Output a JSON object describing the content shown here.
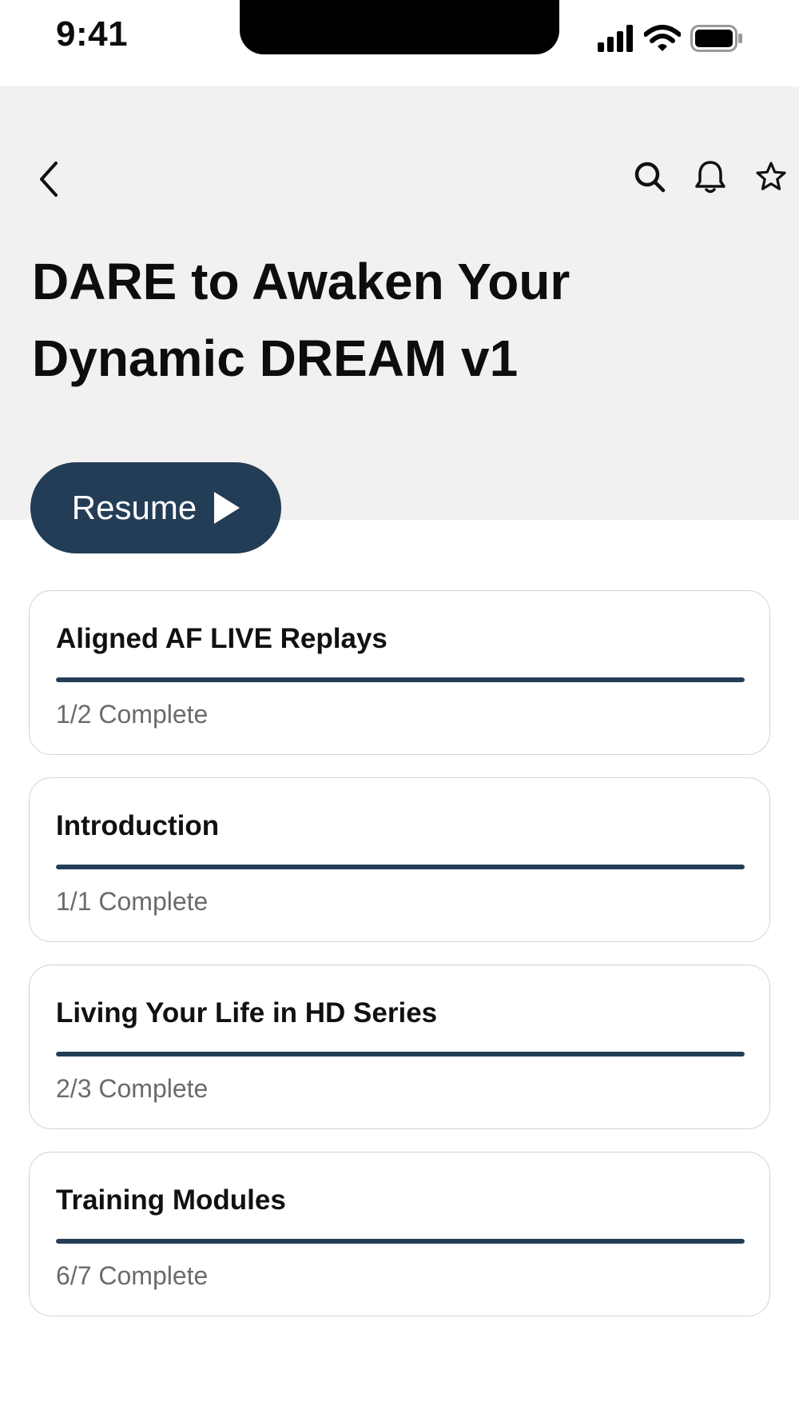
{
  "status_bar": {
    "time": "9:41",
    "icons": [
      "signal-icon",
      "wifi-icon",
      "battery-icon"
    ]
  },
  "header": {
    "back_icon": "chevron-left-icon",
    "actions": [
      "search-icon",
      "bell-icon",
      "star-icon"
    ],
    "title": "DARE to Awaken Your Dynamic DREAM v1"
  },
  "resume": {
    "label": "Resume",
    "icon": "play-icon"
  },
  "colors": {
    "accent": "#233d56",
    "header_bg": "#f1f1f1",
    "card_border": "#d3d3d3",
    "muted_text": "#6b6b6b"
  },
  "modules": [
    {
      "title": "Aligned AF LIVE Replays",
      "status": "1/2 Complete",
      "progress": 1.0
    },
    {
      "title": "Introduction",
      "status": "1/1 Complete",
      "progress": 1.0
    },
    {
      "title": "Living Your Life in HD Series",
      "status": "2/3 Complete",
      "progress": 1.0
    },
    {
      "title": "Training Modules",
      "status": "6/7 Complete",
      "progress": 1.0
    }
  ]
}
